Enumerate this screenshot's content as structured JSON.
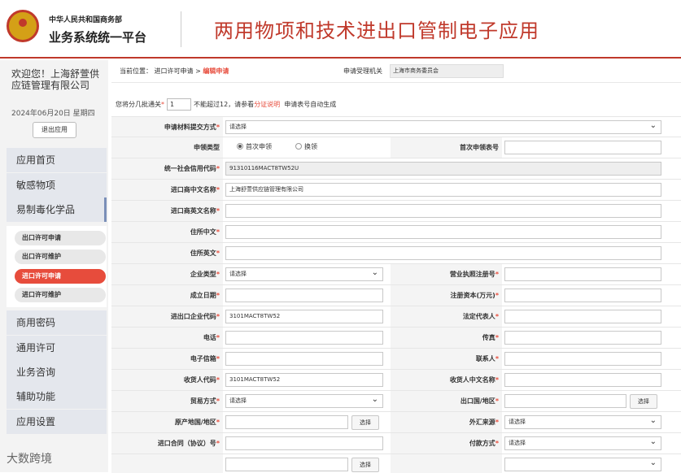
{
  "header": {
    "org_line1": "中华人民共和国商务部",
    "org_line2": "业务系统统一平台",
    "title": "两用物项和技术进出口管制电子应用"
  },
  "sidebar": {
    "welcome": "欢迎您！上海舒萱供应链管理有限公司",
    "date": "2024年06月20日 星期四",
    "logout": "退出应用",
    "nav": [
      "应用首页",
      "敏感物项",
      "易制毒化学品"
    ],
    "sub": [
      "出口许可申请",
      "出口许可维护",
      "进口许可申请",
      "进口许可维护"
    ],
    "nav2": [
      "商用密码",
      "通用许可",
      "业务咨询",
      "辅助功能",
      "应用设置"
    ],
    "watermark": "大数跨境"
  },
  "breadcrumb": {
    "prefix": "当前位置：",
    "path": "进口许可申请 >",
    "current": "编辑申请"
  },
  "agency": {
    "label": "申请受理机关",
    "value": "上海市商务委员会"
  },
  "batch": {
    "pre": "您将分几批通关",
    "value": "1",
    "mid": "不能超过12，请参看",
    "link": "分证说明",
    "post": "申请表号自动生成"
  },
  "form": {
    "submit_method": {
      "label": "申请材料提交方式",
      "value": "请选择"
    },
    "apply_type": {
      "label": "申领类型",
      "opt1": "首次申领",
      "opt2": "换领",
      "first_no_label": "首次申领表号"
    },
    "credit_code": {
      "label": "统一社会信用代码",
      "value": "91310116MACT8TW52U"
    },
    "cn_name": {
      "label": "进口商中文名称",
      "value": "上海舒萱供应链管理有限公司"
    },
    "en_name": {
      "label": "进口商英文名称"
    },
    "addr_cn": {
      "label": "住所中文"
    },
    "addr_en": {
      "label": "住所英文"
    },
    "company_type": {
      "label": "企业类型",
      "value": "请选择"
    },
    "license_no": {
      "label": "营业执照注册号"
    },
    "found_date": {
      "label": "成立日期"
    },
    "capital": {
      "label": "注册资本(万元)"
    },
    "ie_code": {
      "label": "进出口企业代码",
      "value": "3101MACT8TW52"
    },
    "legal_rep": {
      "label": "法定代表人"
    },
    "phone": {
      "label": "电话"
    },
    "fax": {
      "label": "传真"
    },
    "email": {
      "label": "电子信箱"
    },
    "contact": {
      "label": "联系人"
    },
    "consignee_code": {
      "label": "收货人代码",
      "value": "3101MACT8TW52"
    },
    "consignee_cn": {
      "label": "收货人中文名称"
    },
    "trade_mode": {
      "label": "贸易方式",
      "value": "请选择"
    },
    "export_country": {
      "label": "出口国/地区"
    },
    "origin_country": {
      "label": "原产地国/地区"
    },
    "forex": {
      "label": "外汇来源",
      "value": "请选择"
    },
    "contract_no": {
      "label": "进口合同（协议）号"
    },
    "payment": {
      "label": "付款方式",
      "value": "请选择"
    },
    "select_btn": "选择"
  }
}
